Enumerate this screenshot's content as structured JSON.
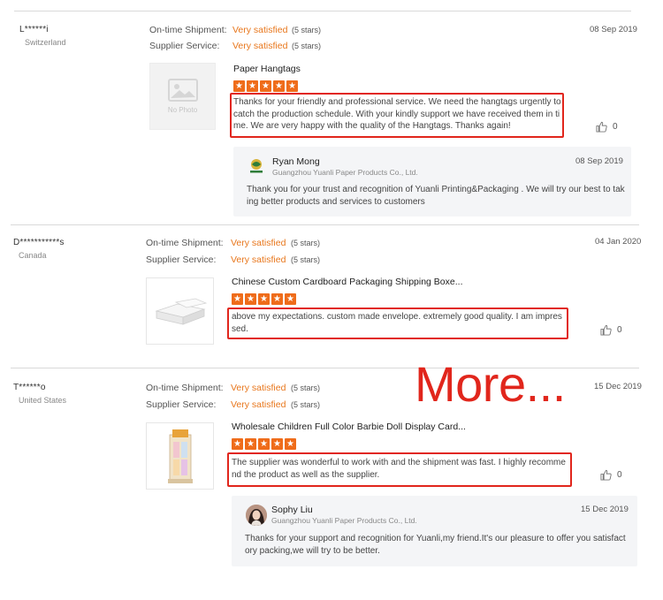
{
  "reviews": [
    {
      "buyer": "L******i",
      "country": "Switzerland",
      "date": "08 Sep 2019",
      "ontime_label": "On-time Shipment:",
      "ontime_value": "Very satisfied",
      "ontime_stars": "(5 stars)",
      "supplier_label": "Supplier Service:",
      "supplier_value": "Very satisfied",
      "supplier_stars": "(5 stars)",
      "thumb_text": "No Photo",
      "product": "Paper Hangtags",
      "rating": 5,
      "text": "Thanks for your friendly and professional service. We need the hangtags urgently to catch the production schedule. With your kindly support we have received them in time. We are very happy with the quality of the Hangtags. Thanks again!",
      "likes": "0",
      "reply": {
        "name": "Ryan Mong",
        "company": "Guangzhou Yuanli Paper Products Co., Ltd.",
        "date": "08 Sep 2019",
        "text": "Thank you for your trust and recognition of Yuanli Printing&Packaging . We will try our best to taking better products and services to customers"
      }
    },
    {
      "buyer": "D***********s",
      "country": "Canada",
      "date": "04 Jan 2020",
      "ontime_label": "On-time Shipment:",
      "ontime_value": "Very satisfied",
      "ontime_stars": "(5 stars)",
      "supplier_label": "Supplier Service:",
      "supplier_value": "Very satisfied",
      "supplier_stars": "(5 stars)",
      "product": "Chinese Custom Cardboard Packaging Shipping Boxe...",
      "rating": 5,
      "text": "above my expectations. custom made envelope. extremely good quality. I am impressed.",
      "likes": "0"
    },
    {
      "buyer": "T******o",
      "country": "United States",
      "date": "15 Dec 2019",
      "ontime_label": "On-time Shipment:",
      "ontime_value": "Very satisfied",
      "ontime_stars": "(5 stars)",
      "supplier_label": "Supplier Service:",
      "supplier_value": "Very satisfied",
      "supplier_stars": "(5 stars)",
      "product": "Wholesale Children Full Color Barbie Doll Display Card...",
      "rating": 5,
      "text": "The supplier was wonderful to work with and the shipment was fast. I highly recommend the product as well as the supplier.",
      "likes": "0",
      "reply": {
        "name": "Sophy Liu",
        "company": "Guangzhou Yuanli Paper Products Co., Ltd.",
        "date": "15 Dec 2019",
        "text": "Thanks for your support and recognition for Yuanli,my friend.It's our pleasure to offer you satisfactory packing,we will try to be better."
      }
    }
  ],
  "overlay": {
    "more": "More..."
  },
  "icons": {
    "thumbs_up": "thumbs-up-icon",
    "star": "star-icon"
  },
  "colors": {
    "accent": "#e8761b",
    "star": "#ef6c1a",
    "highlight": "#e1261c"
  }
}
